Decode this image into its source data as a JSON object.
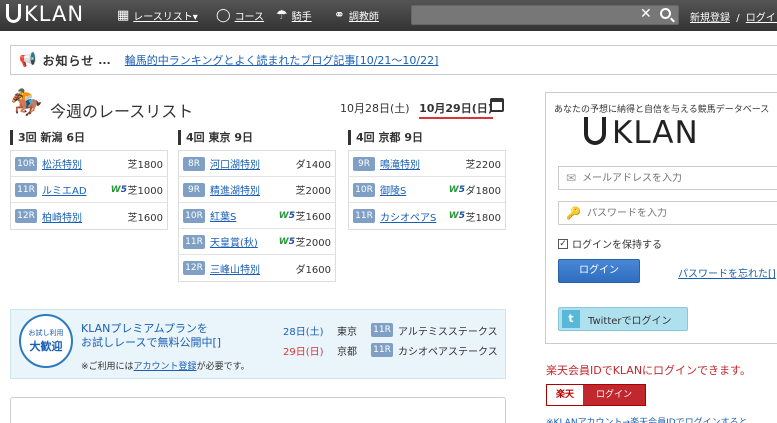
{
  "header": {
    "logo": "KLAN",
    "nav": [
      {
        "icon": "calendar-icon",
        "glyph": "▦",
        "label": "レースリスト▾"
      },
      {
        "icon": "course-icon",
        "glyph": "◯",
        "label": "コース"
      },
      {
        "icon": "jockey-icon",
        "glyph": "☂",
        "label": "騎手"
      },
      {
        "icon": "binoculars-icon",
        "glyph": "⚭",
        "label": "調教師"
      }
    ],
    "search": {
      "placeholder": "",
      "value": ""
    },
    "register_label": "新規登録",
    "separator": "/",
    "login_label": "ログイン"
  },
  "notice": {
    "title": "お知らせ",
    "dots": "...",
    "link": "輪馬的中ランキングとよく読まれたブログ記事[10/21～10/22]"
  },
  "race_list": {
    "title": "今週のレースリスト",
    "date_sat": "10月28日(土)",
    "date_sun": "10月29日(日)",
    "venues": [
      {
        "title": "3回 新潟 6日",
        "races": [
          {
            "no": "10R",
            "name": "松浜特別",
            "win5": false,
            "course": "芝1800"
          },
          {
            "no": "11R",
            "name": "ルミエAD",
            "win5": true,
            "course": "芝1000"
          },
          {
            "no": "12R",
            "name": "柏崎特別",
            "win5": false,
            "course": "芝1600"
          }
        ]
      },
      {
        "title": "4回 東京 9日",
        "races": [
          {
            "no": "8R",
            "name": "河口湖特別",
            "win5": false,
            "course": "ダ1400"
          },
          {
            "no": "9R",
            "name": "精進湖特別",
            "win5": false,
            "course": "芝2000"
          },
          {
            "no": "10R",
            "name": "紅葉S",
            "win5": true,
            "course": "芝1600"
          },
          {
            "no": "11R",
            "name": "天皇賞(秋)",
            "win5": true,
            "course": "芝2000"
          },
          {
            "no": "12R",
            "name": "三峰山特別",
            "win5": false,
            "course": "ダ1600"
          }
        ]
      },
      {
        "title": "4回 京都 9日",
        "races": [
          {
            "no": "9R",
            "name": "鳴滝特別",
            "win5": false,
            "course": "芝2200"
          },
          {
            "no": "10R",
            "name": "御陵S",
            "win5": true,
            "course": "ダ1800"
          },
          {
            "no": "11R",
            "name": "カシオペアS",
            "win5": true,
            "course": "芝1800"
          }
        ]
      }
    ],
    "win5_label": "W5"
  },
  "premium": {
    "badge_top": "お試し利用",
    "badge_main": "大歓迎",
    "line1": "KLANプレミアムプランを",
    "line2": "お試しレースで無料公開中[]",
    "note_prefix": "※ご利用には",
    "note_link": "アカウント登録",
    "note_suffix": "が必要です。",
    "trials": [
      {
        "date": "28日(土)",
        "day": "sat",
        "venue": "東京",
        "no": "11R",
        "name": "アルテミスステークス"
      },
      {
        "date": "29日(日)",
        "day": "sun",
        "venue": "京都",
        "no": "11R",
        "name": "カシオペアステークス"
      }
    ]
  },
  "login_panel": {
    "tagline": "あなたの予想に納得と自信を与える競馬データベース",
    "logo": "KLAN",
    "email_placeholder": "メールアドレスを入力",
    "password_placeholder": "パスワードを入力",
    "remember_label": "ログインを保持する",
    "login_button": "ログイン",
    "forgot_link": "パスワードを忘れた[]",
    "twitter_button": "Twitterでログイン"
  },
  "rakuten": {
    "message": "楽天会員IDでKLANにログインできます。",
    "logo_text": "楽天",
    "button_label": "ログイン",
    "note": "※KLANアカウント→楽天会員IDでログインすると"
  },
  "colors": {
    "accent": "#1a5fb4",
    "race_badge": "#7fa0c4",
    "alert": "#c0282d"
  }
}
